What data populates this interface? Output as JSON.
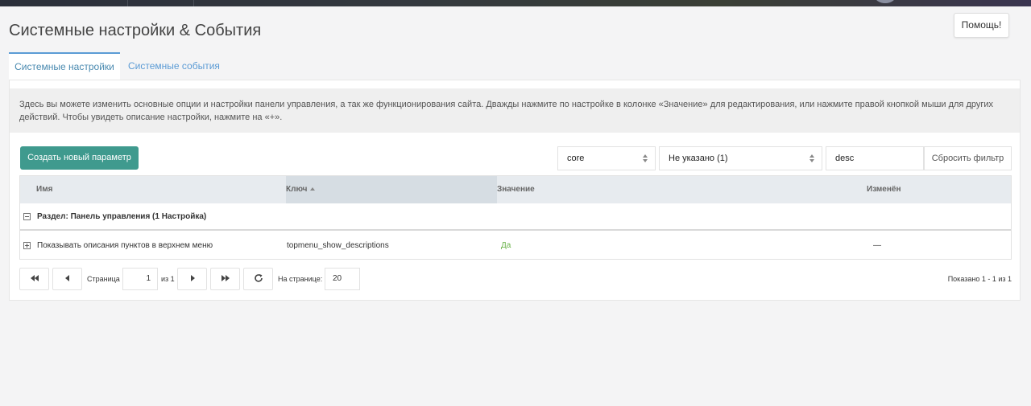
{
  "page_title": "Системные настройки & События",
  "help_label": "Помощь!",
  "tabs": [
    {
      "label": "Системные настройки",
      "active": true
    },
    {
      "label": "Системные события",
      "active": false
    }
  ],
  "description": "Здесь вы можете изменить основные опции и настройки панели управления, а так же функционирования сайта. Дважды нажмите по настройке в колонке «Значение» для редактирования, или нажмите правой кнопкой мыши для других действий. Чтобы увидеть описание настройки, нажмите на «+».",
  "toolbar": {
    "create_label": "Создать новый параметр",
    "namespace_value": "core",
    "area_value": "Не указано (1)",
    "filter_value": "desc",
    "reset_label": "Сбросить фильтр"
  },
  "grid": {
    "columns": [
      "Имя",
      "Ключ",
      "Значение",
      "Изменён"
    ],
    "sorted_column": "Ключ",
    "group_label": "Раздел: Панель управления (1 Настройка)",
    "rows": [
      {
        "name": "Показывать описания пунктов в верхнем меню",
        "key": "topmenu_show_descriptions",
        "value": "Да",
        "modified": "—"
      }
    ]
  },
  "pager": {
    "page_label": "Страница",
    "page_value": "1",
    "of_label": "из 1",
    "per_page_label": "На странице:",
    "per_page_value": "20",
    "summary": "Показано 1 - 1 из 1"
  },
  "colors": {
    "accent": "#5b9bd5",
    "create_button": "#3f9a8e",
    "value_yes": "#6bb34a"
  }
}
